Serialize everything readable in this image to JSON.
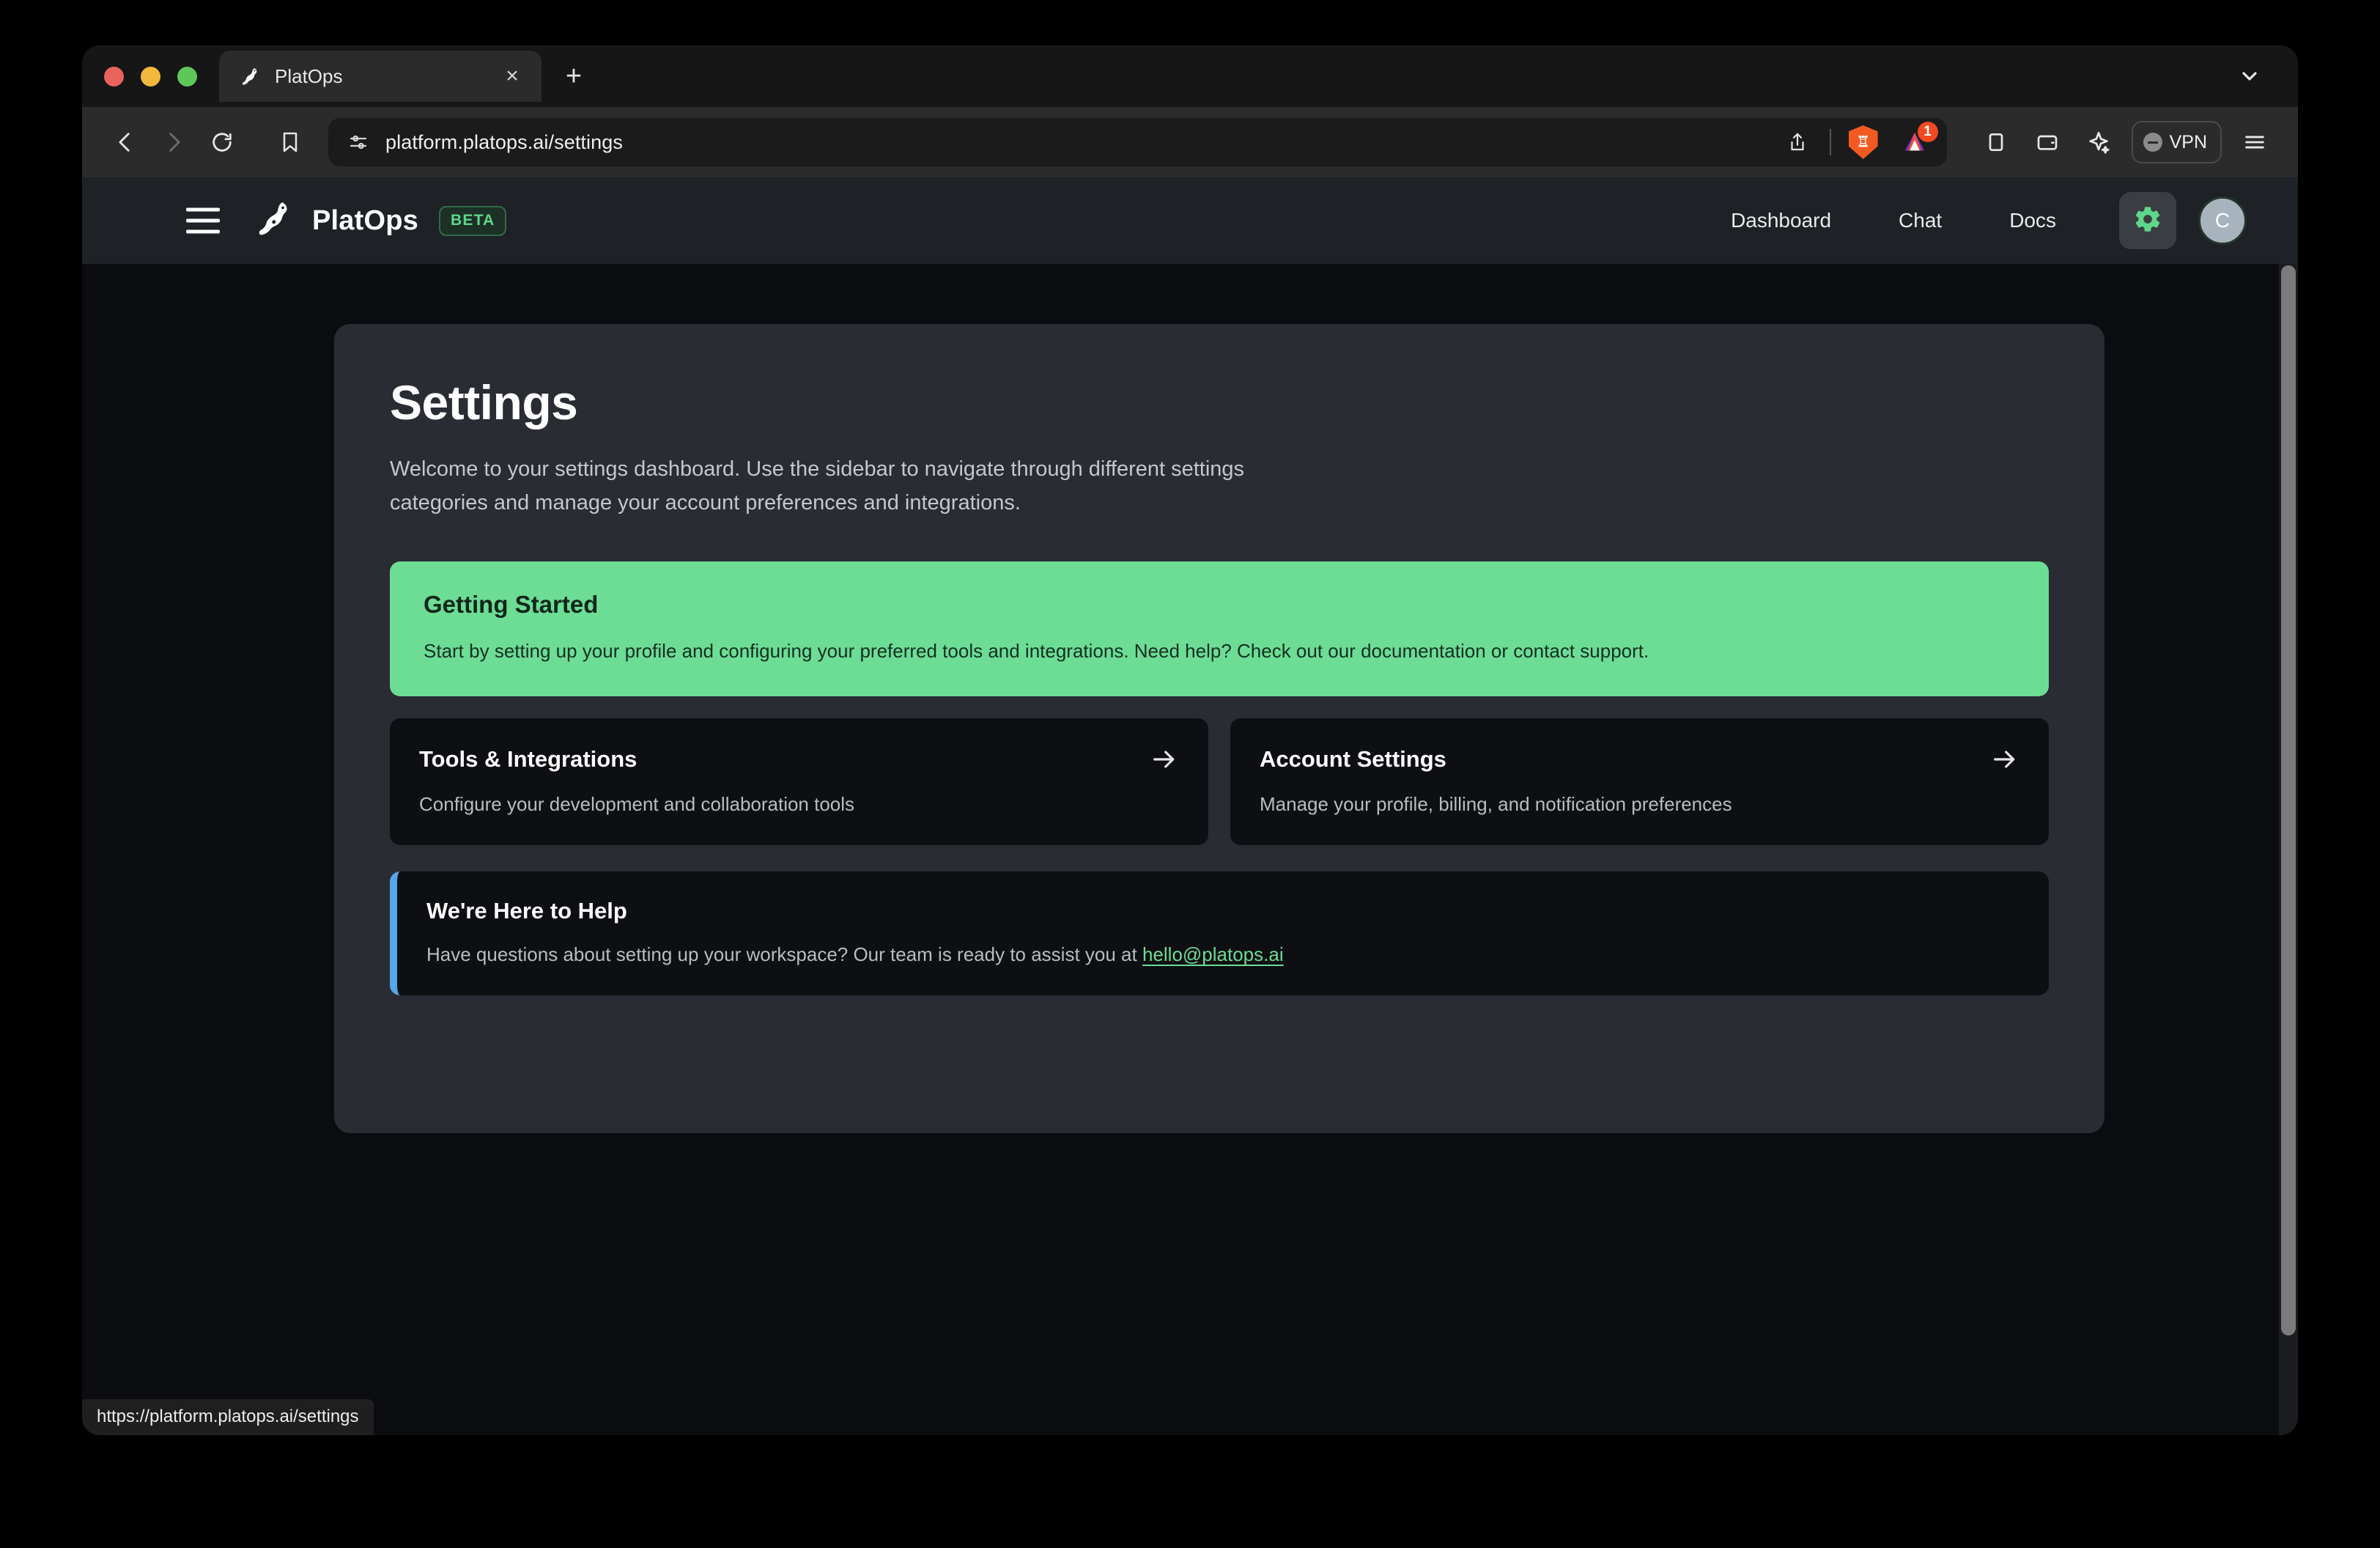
{
  "browser": {
    "traffic_lights": [
      "close",
      "minimize",
      "zoom"
    ],
    "tab": {
      "title": "PlatOps",
      "favicon": "platypus-icon",
      "close_label": "×"
    },
    "new_tab_label": "+",
    "tab_list_icon": "chevron-down-icon",
    "toolbar": {
      "back_icon": "back-arrow-icon",
      "forward_icon": "forward-arrow-icon",
      "reload_icon": "reload-icon",
      "bookmark_icon": "bookmark-icon",
      "url": "platform.platops.ai/settings",
      "url_controls_icon": "site-settings-icon",
      "share_icon": "share-icon",
      "brave_shields_icon": "brave-lion-icon",
      "extension_icon": "extension-icon",
      "extension_badge": "1",
      "sidebar_icon": "sidebar-panel-icon",
      "wallet_icon": "wallet-icon",
      "leo_icon": "leo-sparkle-icon",
      "vpn_label": "VPN",
      "vpn_status_icon": "vpn-off-icon",
      "menu_icon": "hamburger-menu-icon"
    },
    "status_url": "https://platform.platops.ai/settings"
  },
  "app": {
    "menu_icon": "hamburger-menu-icon",
    "logo_icon": "platypus-logo-icon",
    "brand": "PlatOps",
    "badge": "BETA",
    "nav": [
      {
        "label": "Dashboard",
        "name": "nav-dashboard"
      },
      {
        "label": "Chat",
        "name": "nav-chat"
      },
      {
        "label": "Docs",
        "name": "nav-docs"
      }
    ],
    "settings_icon": "gear-icon",
    "avatar_initial": "C"
  },
  "main": {
    "title": "Settings",
    "subtitle": "Welcome to your settings dashboard. Use the sidebar to navigate through different settings categories and manage your account preferences and integrations.",
    "banner": {
      "title": "Getting Started",
      "text": "Start by setting up your profile and configuring your preferred tools and integrations. Need help? Check out our documentation or contact support."
    },
    "cards": [
      {
        "title": "Tools & Integrations",
        "desc": "Configure your development and collaboration tools",
        "arrow_icon": "arrow-right-icon"
      },
      {
        "title": "Account Settings",
        "desc": "Manage your profile, billing, and notification preferences",
        "arrow_icon": "arrow-right-icon"
      }
    ],
    "help": {
      "title": "We're Here to Help",
      "text": "Have questions about setting up your workspace? Our team is ready to assist you at ",
      "link": "hello@platops.ai"
    }
  },
  "colors": {
    "accent_green": "#6ddc95",
    "badge_green": "#5fd68a",
    "callout_blue": "#55a7e8",
    "panel_bg": "#292c33",
    "page_bg": "#0a0c0f",
    "card_bg": "#0d0f12"
  }
}
